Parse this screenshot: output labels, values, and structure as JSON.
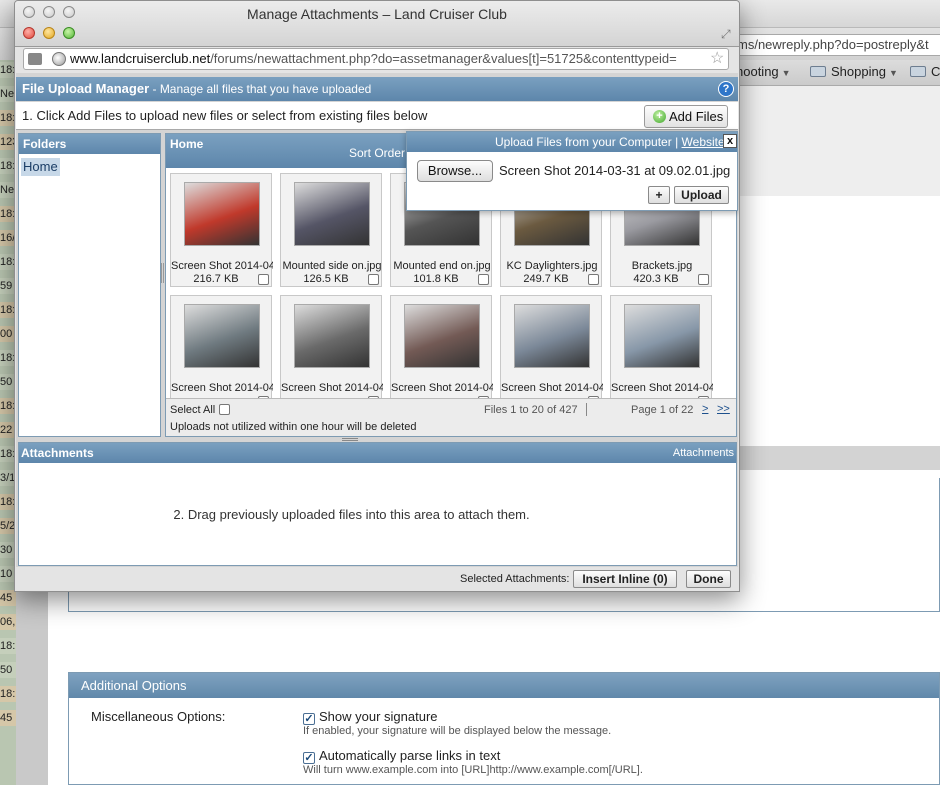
{
  "background": {
    "url_fragment": "ms/newreply.php?do=postreply&t",
    "bookmarks": [
      {
        "label": "hooting",
        "has_folder": false
      },
      {
        "label": "Shopping",
        "has_folder": true
      },
      {
        "label": "C",
        "has_folder": true
      }
    ],
    "left_strip": [
      "18:",
      "Nev",
      "18:",
      "123",
      "18:",
      "Nev",
      "18:",
      "16/",
      "18:",
      "59",
      "18:",
      "00",
      "18:",
      "50",
      "18:",
      "22",
      "18:",
      "3/1",
      "18:",
      "5/2",
      "30",
      "10",
      "45",
      "06,",
      "18:",
      "50",
      "18:",
      "45"
    ],
    "additional_options": {
      "header": "Additional Options",
      "misc_label": "Miscellaneous Options:",
      "options": [
        {
          "label": "Show your signature",
          "desc": "If enabled, your signature will be displayed below the message.",
          "checked": true
        },
        {
          "label": "Automatically parse links in text",
          "desc": "Will turn www.example.com into [URL]http://www.example.com[/URL].",
          "checked": true
        }
      ]
    }
  },
  "window": {
    "title": "Manage Attachments – Land Cruiser Club",
    "url_host": "www.landcruiserclub.net",
    "url_path": "/forums/newattachment.php?do=assetmanager&values[t]=51725&contenttypeid="
  },
  "manager": {
    "title": "File Upload Manager",
    "subtitle": "- Manage all files that you have uploaded",
    "help": "?",
    "step1": "1. Click Add Files to upload new files or select from existing files below",
    "add_files": "Add Files",
    "folders_header": "Folders",
    "folder_home": "Home",
    "files_header": "Home",
    "sort_order": "Sort Order:",
    "files": [
      {
        "name": "Screen Shot 2014-04-",
        "size": "216.7 KB",
        "tone": "#c0392b"
      },
      {
        "name": "Mounted side on.jpg",
        "size": "126.5 KB",
        "tone": "#556"
      },
      {
        "name": "Mounted end on.jpg",
        "size": "101.8 KB",
        "tone": "#555"
      },
      {
        "name": "KC Daylighters.jpg",
        "size": "249.7 KB",
        "tone": "#6b5a40"
      },
      {
        "name": "Brackets.jpg",
        "size": "420.3 KB",
        "tone": "#9a9aa0"
      },
      {
        "name": "Screen Shot 2014-04-",
        "size": "",
        "tone": "#6f7a80"
      },
      {
        "name": "Screen Shot 2014-04-",
        "size": "",
        "tone": "#6a6a6a"
      },
      {
        "name": "Screen Shot 2014-04-",
        "size": "",
        "tone": "#735a55"
      },
      {
        "name": "Screen Shot 2014-04-",
        "size": "",
        "tone": "#7b8898"
      },
      {
        "name": "Screen Shot 2014-04-",
        "size": "",
        "tone": "#8797a8"
      }
    ],
    "select_all": "Select All",
    "files_count": "Files 1 to 20 of 427",
    "page_of": "Page 1 of 22",
    "next": ">",
    "last": ">>",
    "uploads_note": "Uploads not utilized within one hour will be deleted",
    "upload_box": {
      "header": "Upload Files from your Computer |",
      "website": "Website",
      "close": "x",
      "browse": "Browse...",
      "file_chosen": "Screen Shot 2014-03-31 at 09.02.01.jpg",
      "plus": "+",
      "upload": "Upload"
    },
    "attachments_header": "Attachments",
    "attachments_header_right": "Attachments",
    "drag_text": "2. Drag previously uploaded files into this area to attach them.",
    "selected_label": "Selected Attachments:",
    "insert_inline": "Insert Inline (0)",
    "done": "Done"
  }
}
